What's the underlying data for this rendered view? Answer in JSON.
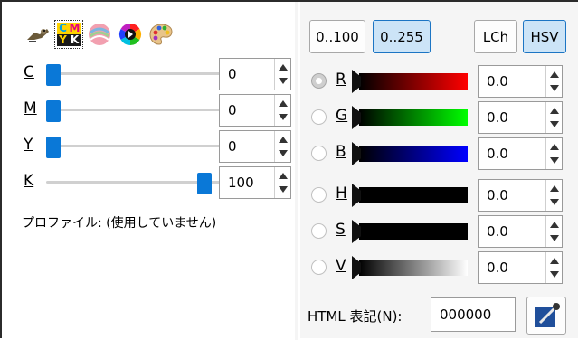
{
  "tools": [
    {
      "name": "gimp-icon"
    },
    {
      "name": "cmyk-icon",
      "letters": [
        "C",
        "M",
        "Y",
        "K"
      ]
    },
    {
      "name": "watercolor-icon"
    },
    {
      "name": "color-wheel-icon"
    },
    {
      "name": "palette-icon"
    }
  ],
  "cmyk": [
    {
      "label": "C",
      "value": "0",
      "level": 0
    },
    {
      "label": "M",
      "value": "0",
      "level": 0
    },
    {
      "label": "Y",
      "value": "0",
      "level": 0
    },
    {
      "label": "K",
      "value": "100",
      "level": 1
    }
  ],
  "profile_text": "プロファイル: (使用していません)",
  "range_buttons": {
    "b100": "0..100",
    "b255": "0..255",
    "active": "0..255"
  },
  "model_buttons": {
    "lch": "LCh",
    "hsv": "HSV",
    "active": "HSV"
  },
  "channels": [
    {
      "label": "R",
      "value": "0.0",
      "checked": true,
      "end_color": "#ff0000"
    },
    {
      "label": "G",
      "value": "0.0",
      "checked": false,
      "end_color": "#00ff00"
    },
    {
      "label": "B",
      "value": "0.0",
      "checked": false,
      "end_color": "#0000ff"
    },
    {
      "label": "H",
      "value": "0.0",
      "checked": false,
      "end_color": "#000000"
    },
    {
      "label": "S",
      "value": "0.0",
      "checked": false,
      "end_color": "#000000"
    },
    {
      "label": "V",
      "value": "0.0",
      "checked": false,
      "end_color": "#ffffff"
    }
  ],
  "html_notation": {
    "label": "HTML 表記(N):",
    "value": "000000"
  }
}
